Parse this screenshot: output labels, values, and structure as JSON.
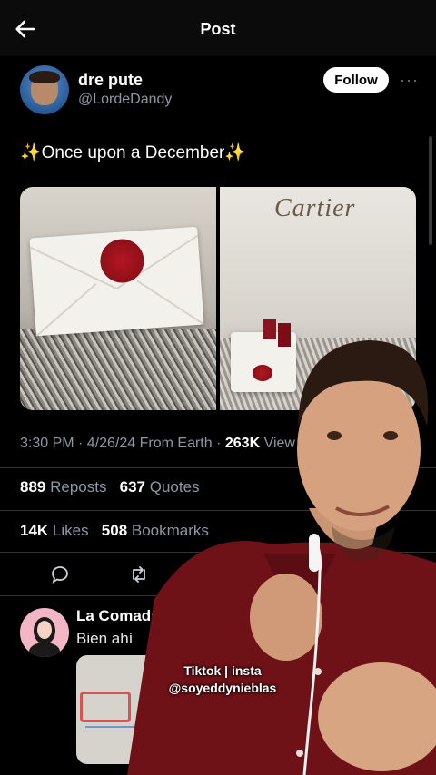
{
  "header": {
    "title": "Post"
  },
  "author": {
    "name": "dre pute",
    "handle": "@LordeDandy",
    "follow_label": "Follow"
  },
  "post": {
    "text": "✨Once upon a December✨",
    "image_2_brand": "Cartier",
    "meta_prefix": "3:30 PM · 4/26/24 From Earth · ",
    "views_count": "263K",
    "views_label": " View"
  },
  "stats": {
    "reposts_count": "889",
    "reposts_label": " Reposts",
    "quotes_count": "637",
    "quotes_label": " Quotes",
    "likes_count": "14K",
    "likes_label": " Likes",
    "bookmarks_count": "508",
    "bookmarks_label": " Bookmarks"
  },
  "reply": {
    "name": "La Comadrit",
    "text": "Bien ahí"
  },
  "overlay": {
    "caption_line1": "Tiktok | insta",
    "caption_line2": "@soyeddynieblas"
  },
  "icons": {
    "back": "arrow-left-icon",
    "more": "more-dots-icon",
    "reply": "reply-bubble-icon",
    "repost": "repost-icon",
    "sparkles": "sparkles-emoji"
  },
  "colors": {
    "background": "#000000",
    "muted": "#8b98a5",
    "seal": "#9e1420",
    "shirt": "#6e1218"
  }
}
